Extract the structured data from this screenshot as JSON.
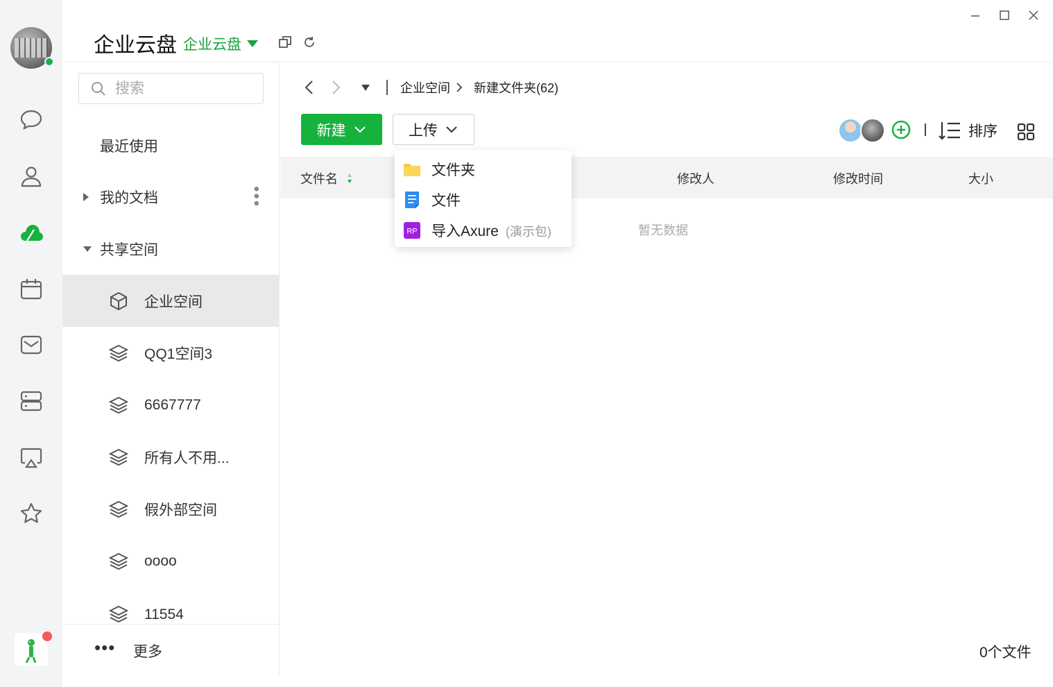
{
  "app": {
    "title": "企业云盘",
    "space_switch": "企业云盘"
  },
  "colors": {
    "accent": "#15b23d",
    "rail_bg": "#f3f4f6",
    "active_row": "#e9e9eb",
    "axure_purple": "#a21fe0"
  },
  "search": {
    "placeholder": "搜索"
  },
  "sidebar": {
    "recent": "最近使用",
    "my_docs": "我的文档",
    "shared": "共享空间",
    "spaces": [
      {
        "label": "企业空间",
        "icon": "cube-icon",
        "active": true
      },
      {
        "label": "QQ1空间3",
        "icon": "layers-icon"
      },
      {
        "label": "6667777",
        "icon": "layers-icon"
      },
      {
        "label": "所有人不用...",
        "icon": "layers-icon"
      },
      {
        "label": "假外部空间",
        "icon": "layers-icon"
      },
      {
        "label": "oooo",
        "icon": "layers-icon"
      },
      {
        "label": "11554",
        "icon": "layers-icon"
      }
    ],
    "more": "更多"
  },
  "breadcrumb": {
    "root": "企业空间",
    "current": "新建文件夹(62)"
  },
  "toolbar": {
    "new_label": "新建",
    "upload_label": "上传",
    "sort_label": "排序"
  },
  "upload_menu": {
    "items": [
      {
        "label": "文件夹",
        "icon": "folder-icon"
      },
      {
        "label": "文件",
        "icon": "file-icon"
      },
      {
        "label": "导入Axure",
        "note": "(演示包)",
        "icon": "axure-rp-icon"
      }
    ]
  },
  "table": {
    "headers": {
      "name": "文件名",
      "modifier": "修改人",
      "modified_time": "修改时间",
      "size": "大小"
    },
    "empty_text": "暂无数据"
  },
  "footer": {
    "file_count": "0个文件"
  }
}
